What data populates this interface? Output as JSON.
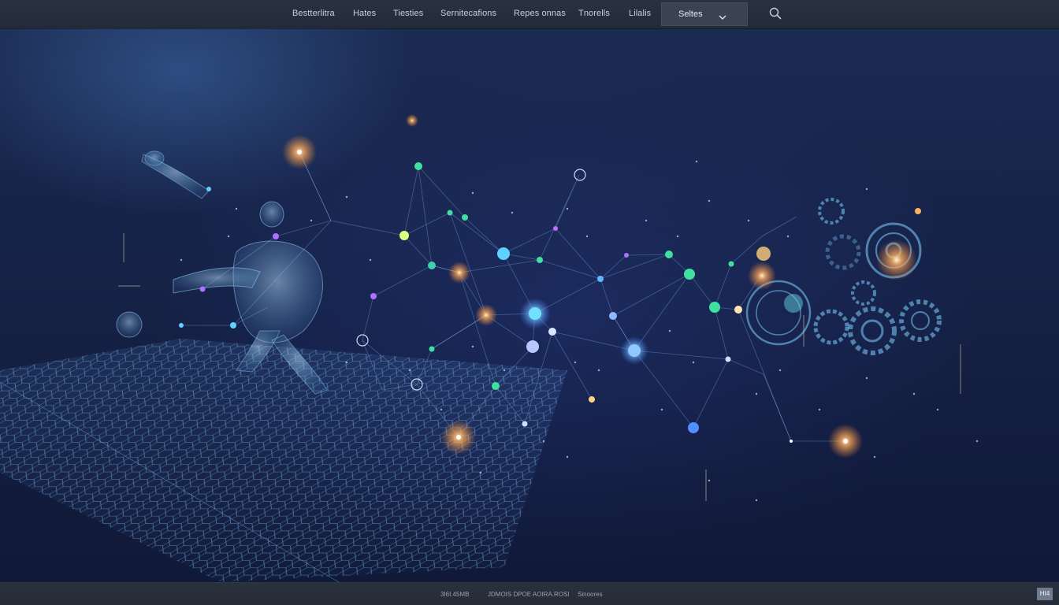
{
  "nav": {
    "items": [
      {
        "label": "Bestterlitra"
      },
      {
        "label": "Hates"
      },
      {
        "label": "Tiesties"
      },
      {
        "label": "Sernitecafions"
      },
      {
        "label": "Repes onnas"
      },
      {
        "label": "Tnorells"
      },
      {
        "label": "Lilalis"
      }
    ],
    "select": {
      "label": "Seltes"
    },
    "search_icon": "search-icon",
    "chevron_icon": "chevron-down-icon"
  },
  "footer": {
    "items": [
      {
        "label": "3I6I.45MB"
      },
      {
        "label": "JDMOIS DPOE AOIRA.ROSI"
      },
      {
        "label": "Sinoores"
      }
    ],
    "badge": "HI4"
  },
  "colors": {
    "nav_bg": "#262d3b",
    "accent_teal": "#3fe0a0",
    "accent_blue": "#5fb8ff",
    "accent_orange": "#ffb060",
    "accent_purple": "#b070ff"
  }
}
